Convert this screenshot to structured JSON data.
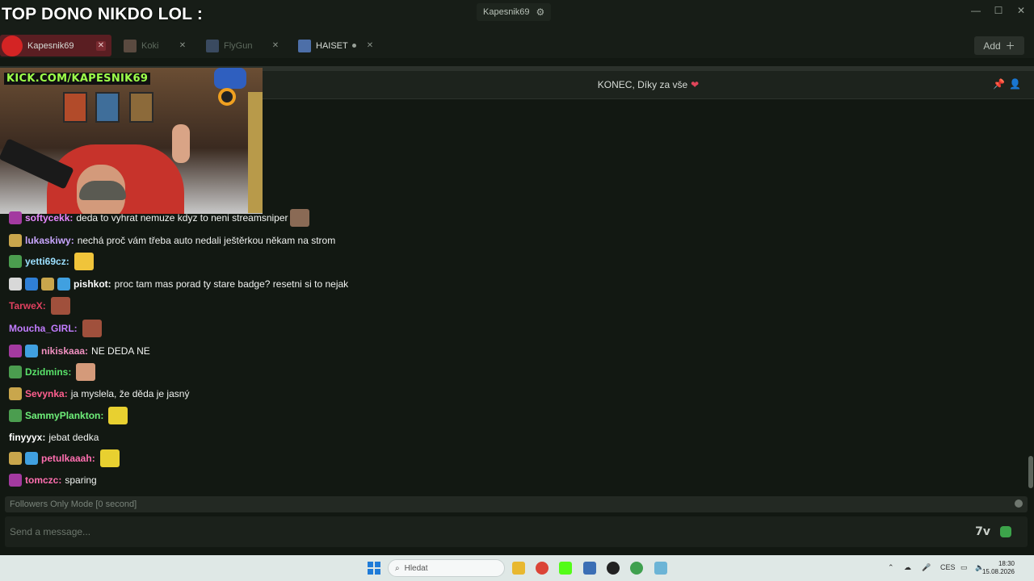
{
  "titlebar": {
    "overlay_title": "TOP DONO NIKDO LOL :",
    "account_name": "Kapesnik69",
    "settings_icon": "gear-icon",
    "controls": {
      "minimize": "—",
      "maximize": "☐",
      "close": "✕"
    }
  },
  "tabs": [
    {
      "label": "Kapesnik69",
      "active": true
    },
    {
      "label": "Koki",
      "active": false
    },
    {
      "label": "FlyGun",
      "active": false
    },
    {
      "label": "HAISET",
      "active": false,
      "live": true
    }
  ],
  "add_button": {
    "label": "Add",
    "icon": "plus-icon"
  },
  "preview": {
    "watermark": "KICK.COM/KAPESNIK69"
  },
  "chat_header": {
    "notice": "KONEC, Díky za vše",
    "heart": "❤",
    "icons": [
      "pin-icon",
      "users-icon"
    ]
  },
  "messages": [
    {
      "user": "softycekk:",
      "text": "deda to vyhrat nemuze kdyz to neni streamsniper",
      "color": "#e889ff",
      "badges": [
        "#a33aa0"
      ],
      "emote": "#8a6a55"
    },
    {
      "user": "lukaskiwy:",
      "text": "nechá proč vám třeba auto nedali ještěrkou někam na strom",
      "color": "#c9a6ff",
      "badges": [
        "#c9a64c"
      ],
      "emote": ""
    },
    {
      "user": "yetti69cz:",
      "text": "",
      "color": "#9be0ff",
      "badges": [
        "#4b9d4f"
      ],
      "emote": "#f0c43a"
    },
    {
      "user": "pishkot:",
      "text": "proc tam mas porad ty stare badge? resetni si to nejak",
      "color": "#ffffff",
      "badges": [
        "#d8d8d8",
        "#2f7fd6",
        "#c9a64c",
        "#40a0e0"
      ],
      "emote": ""
    },
    {
      "user": "TarweX:",
      "text": "",
      "color": "#e0405f",
      "badges": [],
      "emote": "#a0503c"
    },
    {
      "user": "Moucha_GIRL:",
      "text": "",
      "color": "#c27dff",
      "badges": [],
      "emote": "#a0503c"
    },
    {
      "user": "nikiskaaa:",
      "text": "NE DEDA NE",
      "color": "#f090c0",
      "badges": [
        "#a33aa0",
        "#40a0e0"
      ],
      "emote": ""
    },
    {
      "user": "Dzidmins:",
      "text": "",
      "color": "#59e36a",
      "badges": [
        "#4b9d4f"
      ],
      "emote": "#d49a7a"
    },
    {
      "user": "Sevynka:",
      "text": "ja myslela, že děda je jasný",
      "color": "#ff5f8f",
      "badges": [
        "#c9a64c"
      ],
      "emote": ""
    },
    {
      "user": "SammyPlankton:",
      "text": "",
      "color": "#6ff07a",
      "badges": [
        "#4b9d4f"
      ],
      "emote": "#e8d030"
    },
    {
      "user": "finyyyx:",
      "text": "jebat dedka",
      "color": "#ffffff",
      "badges": [],
      "emote": ""
    },
    {
      "user": "petulkaaah:",
      "text": "",
      "color": "#ff6fb0",
      "badges": [
        "#c9a64c",
        "#40a0e0"
      ],
      "emote": "#e8d030"
    },
    {
      "user": "tomczc:",
      "text": "sparing",
      "color": "#ff6fb0",
      "badges": [
        "#a33aa0"
      ],
      "emote": ""
    }
  ],
  "mode_notice": "Followers Only Mode [0 second]",
  "chat_input": {
    "placeholder": "Send a message..."
  },
  "taskbar": {
    "search_placeholder": "Hledat",
    "language": "CES",
    "time": "18:30",
    "date": "15.08.2026"
  }
}
